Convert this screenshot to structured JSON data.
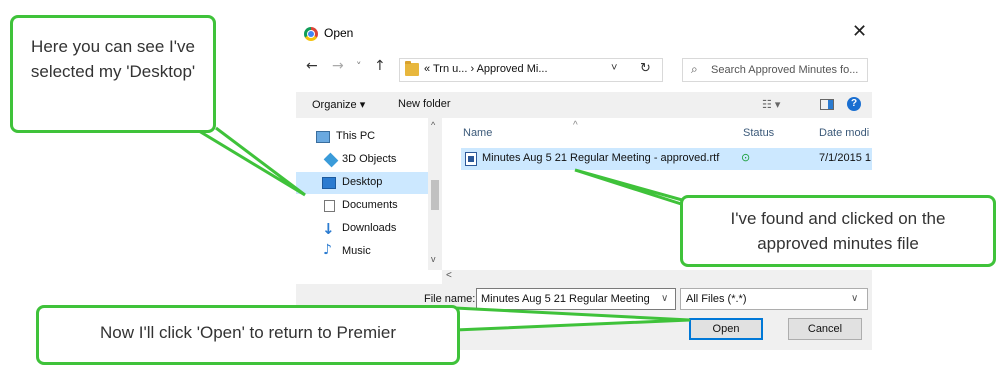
{
  "dialog": {
    "title": "Open",
    "close_glyph": "✕",
    "nav": {
      "back": "←",
      "forward": "→",
      "recent": "˅",
      "up": "↑"
    },
    "address": "« Trn u...  ›  Approved Mi...",
    "address_chevron": "˅",
    "refresh_glyph": "↻",
    "search_placeholder": "Search Approved Minutes fo...",
    "toolbar": {
      "organize": "Organize ▾",
      "new_folder": "New folder",
      "view": "☷ ▾",
      "help": "?"
    },
    "nav_pane": {
      "items": [
        {
          "label": "This PC",
          "icon": "computer-icon"
        },
        {
          "label": "3D Objects",
          "icon": "cube-icon"
        },
        {
          "label": "Desktop",
          "icon": "desktop-icon",
          "selected": true
        },
        {
          "label": "Documents",
          "icon": "documents-icon"
        },
        {
          "label": "Downloads",
          "icon": "downloads-icon"
        },
        {
          "label": "Music",
          "icon": "music-icon"
        }
      ],
      "scroll_up": "^",
      "scroll_down": "v"
    },
    "list": {
      "columns": {
        "name": "Name",
        "status": "Status",
        "date": "Date modi"
      },
      "sort_arrow": "^",
      "files": [
        {
          "name": "Minutes Aug 5 21 Regular Meeting - approved.rtf",
          "status": "⊙",
          "date": "7/1/2015 1",
          "selected": true
        }
      ],
      "hscroll_left": "<"
    },
    "bottom": {
      "file_name_label": "File name:",
      "file_name_value": "Minutes Aug 5 21 Regular Meeting",
      "file_name_chevron": "∨",
      "file_type": "All Files (*.*)",
      "file_type_chevron": "∨",
      "open": "Open",
      "cancel": "Cancel"
    }
  },
  "callouts": {
    "desktop": "Here you can see I've selected my 'Desktop'",
    "file": "I've found and clicked on the approved minutes file",
    "open": "Now I'll click 'Open' to return to Premier"
  },
  "colors": {
    "callout_border": "#3fc23a",
    "selection": "#cce8ff",
    "accent": "#0078d7"
  }
}
